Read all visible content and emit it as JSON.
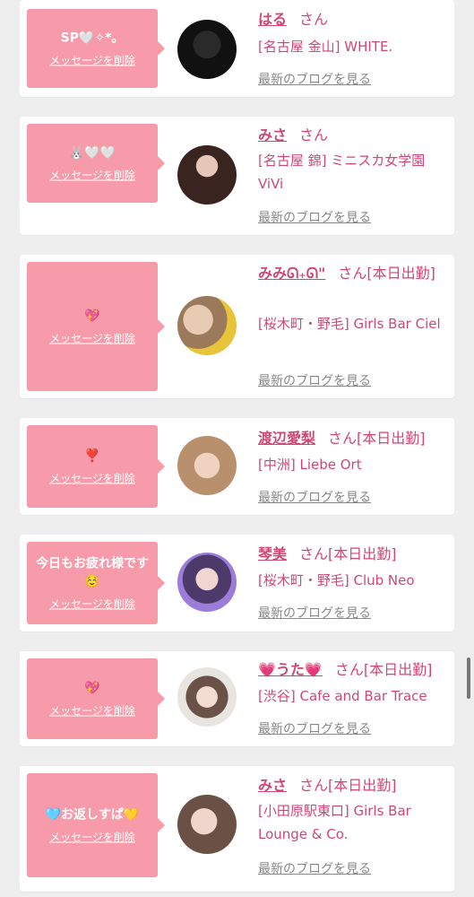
{
  "common": {
    "delete_label": "メッセージを削除",
    "blog_label": "最新のブログを見る",
    "honorific": "さん"
  },
  "colors": {
    "background": "#eeeeee",
    "bubble": "#f79aaa",
    "accent": "#d14774",
    "muted": "#888888"
  },
  "entries": [
    {
      "message": "SP🤍✧*。",
      "name": "はる",
      "status": "",
      "shop": "[名古屋 金山] WHITE."
    },
    {
      "message": "🐰🤍🤍",
      "name": "みさ",
      "status": "",
      "shop": "[名古屋 錦] ミニスカ女学園ViVi"
    },
    {
      "message": "💖",
      "name": "みみᘏ₊ᘏ\"",
      "status": "[本日出勤]",
      "shop": "[桜木町・野毛] Girls Bar Ciel"
    },
    {
      "message": "❣️",
      "name": "渡辺愛梨",
      "status": "[本日出勤]",
      "shop": "[中洲] Liebe Ort"
    },
    {
      "message": "今日もお疲れ様です☺️",
      "name": "琴美",
      "status": "[本日出勤]",
      "shop": "[桜木町・野毛] Club Neo"
    },
    {
      "message": "💖",
      "name": "💗うた💗",
      "status": "[本日出勤]",
      "shop": "[渋谷] Cafe and Bar Trace"
    },
    {
      "message": "🩵お返しすぱ💛",
      "name": "みさ",
      "status": "[本日出勤]",
      "shop": "[小田原駅東口] Girls Bar Lounge & Co."
    }
  ]
}
